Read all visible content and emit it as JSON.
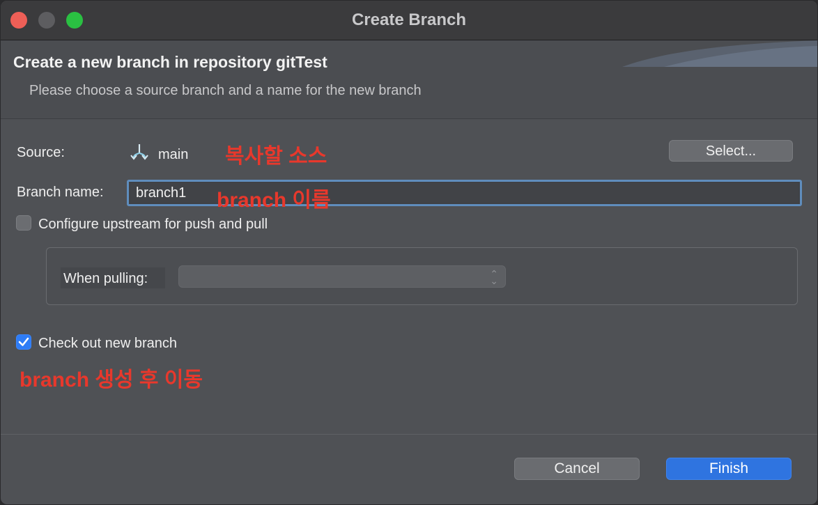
{
  "window": {
    "title": "Create Branch"
  },
  "banner": {
    "title": "Create a new branch in repository gitTest",
    "subtitle": "Please choose a source branch and a name for the new branch"
  },
  "form": {
    "source_label": "Source:",
    "source_value": "main",
    "source_icon": "branch-icon",
    "select_button": "Select...",
    "branch_name_label": "Branch name:",
    "branch_name_value": "branch1",
    "upstream_checkbox_label": "Configure upstream for push and pull",
    "upstream_checked": false,
    "when_pulling_label": "When pulling:",
    "when_pulling_value": "",
    "checkout_label": "Check out new branch",
    "checkout_checked": true
  },
  "annotations": {
    "source_note": "복사할 소스",
    "name_note": "branch 이름",
    "checkout_note": "branch 생성 후 이동"
  },
  "buttons": {
    "cancel": "Cancel",
    "finish": "Finish"
  },
  "colors": {
    "accent": "#2f74e0",
    "annotation": "#e8382c",
    "focus_ring": "#5f8dbd"
  }
}
